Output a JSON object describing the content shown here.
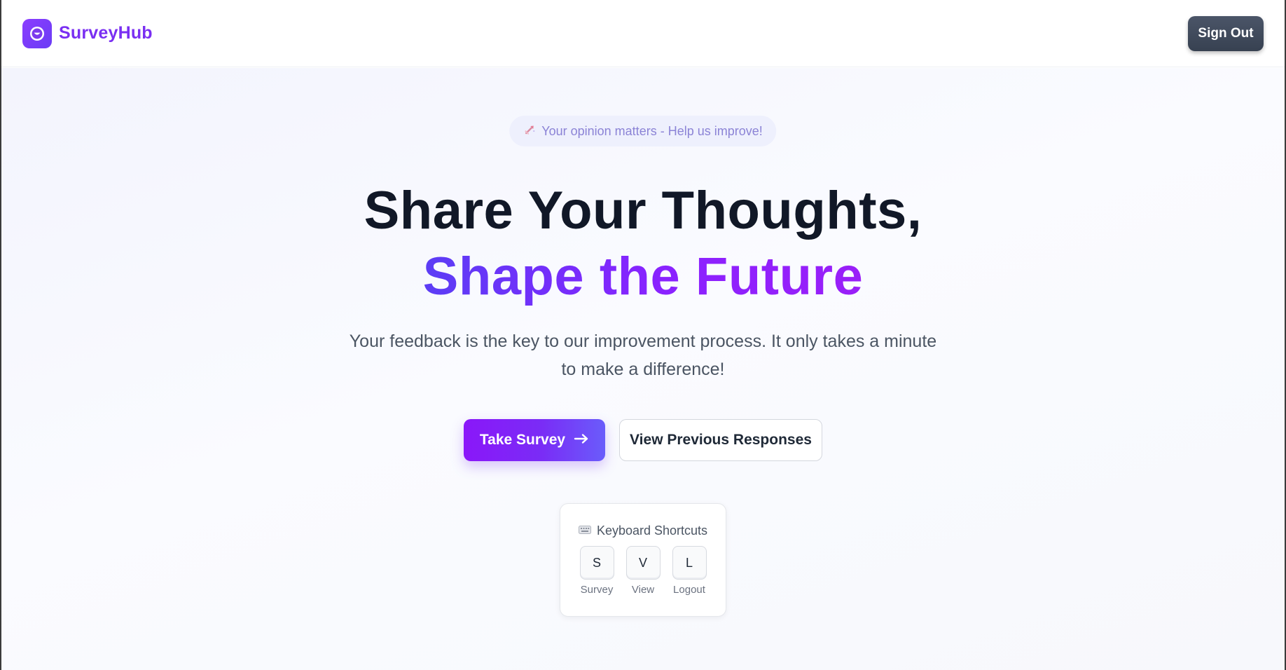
{
  "header": {
    "brand_name": "SurveyHub",
    "logo_icon": "smile-chat-icon",
    "sign_out_label": "Sign Out"
  },
  "hero": {
    "badge_icon": "rocket-icon",
    "badge_text": "Your opinion matters - Help us improve!",
    "headline_line1": "Share Your Thoughts,",
    "headline_line2": "Shape the Future",
    "subtitle": "Your feedback is the key to our improvement process. It only takes a minute to make a difference!",
    "primary_button_label": "Take Survey",
    "primary_button_icon": "arrow-right-icon",
    "secondary_button_label": "View Previous Responses"
  },
  "shortcuts": {
    "icon": "keyboard-icon",
    "title": "Keyboard Shortcuts",
    "items": [
      {
        "key": "S",
        "label": "Survey"
      },
      {
        "key": "V",
        "label": "View"
      },
      {
        "key": "L",
        "label": "Logout"
      }
    ]
  },
  "colors": {
    "brand": "#7a2ff2",
    "primary_gradient_start": "#8a17f9",
    "primary_gradient_end": "#6a5cfb",
    "signout_bg": "#374151",
    "headline_dark": "#111827"
  }
}
